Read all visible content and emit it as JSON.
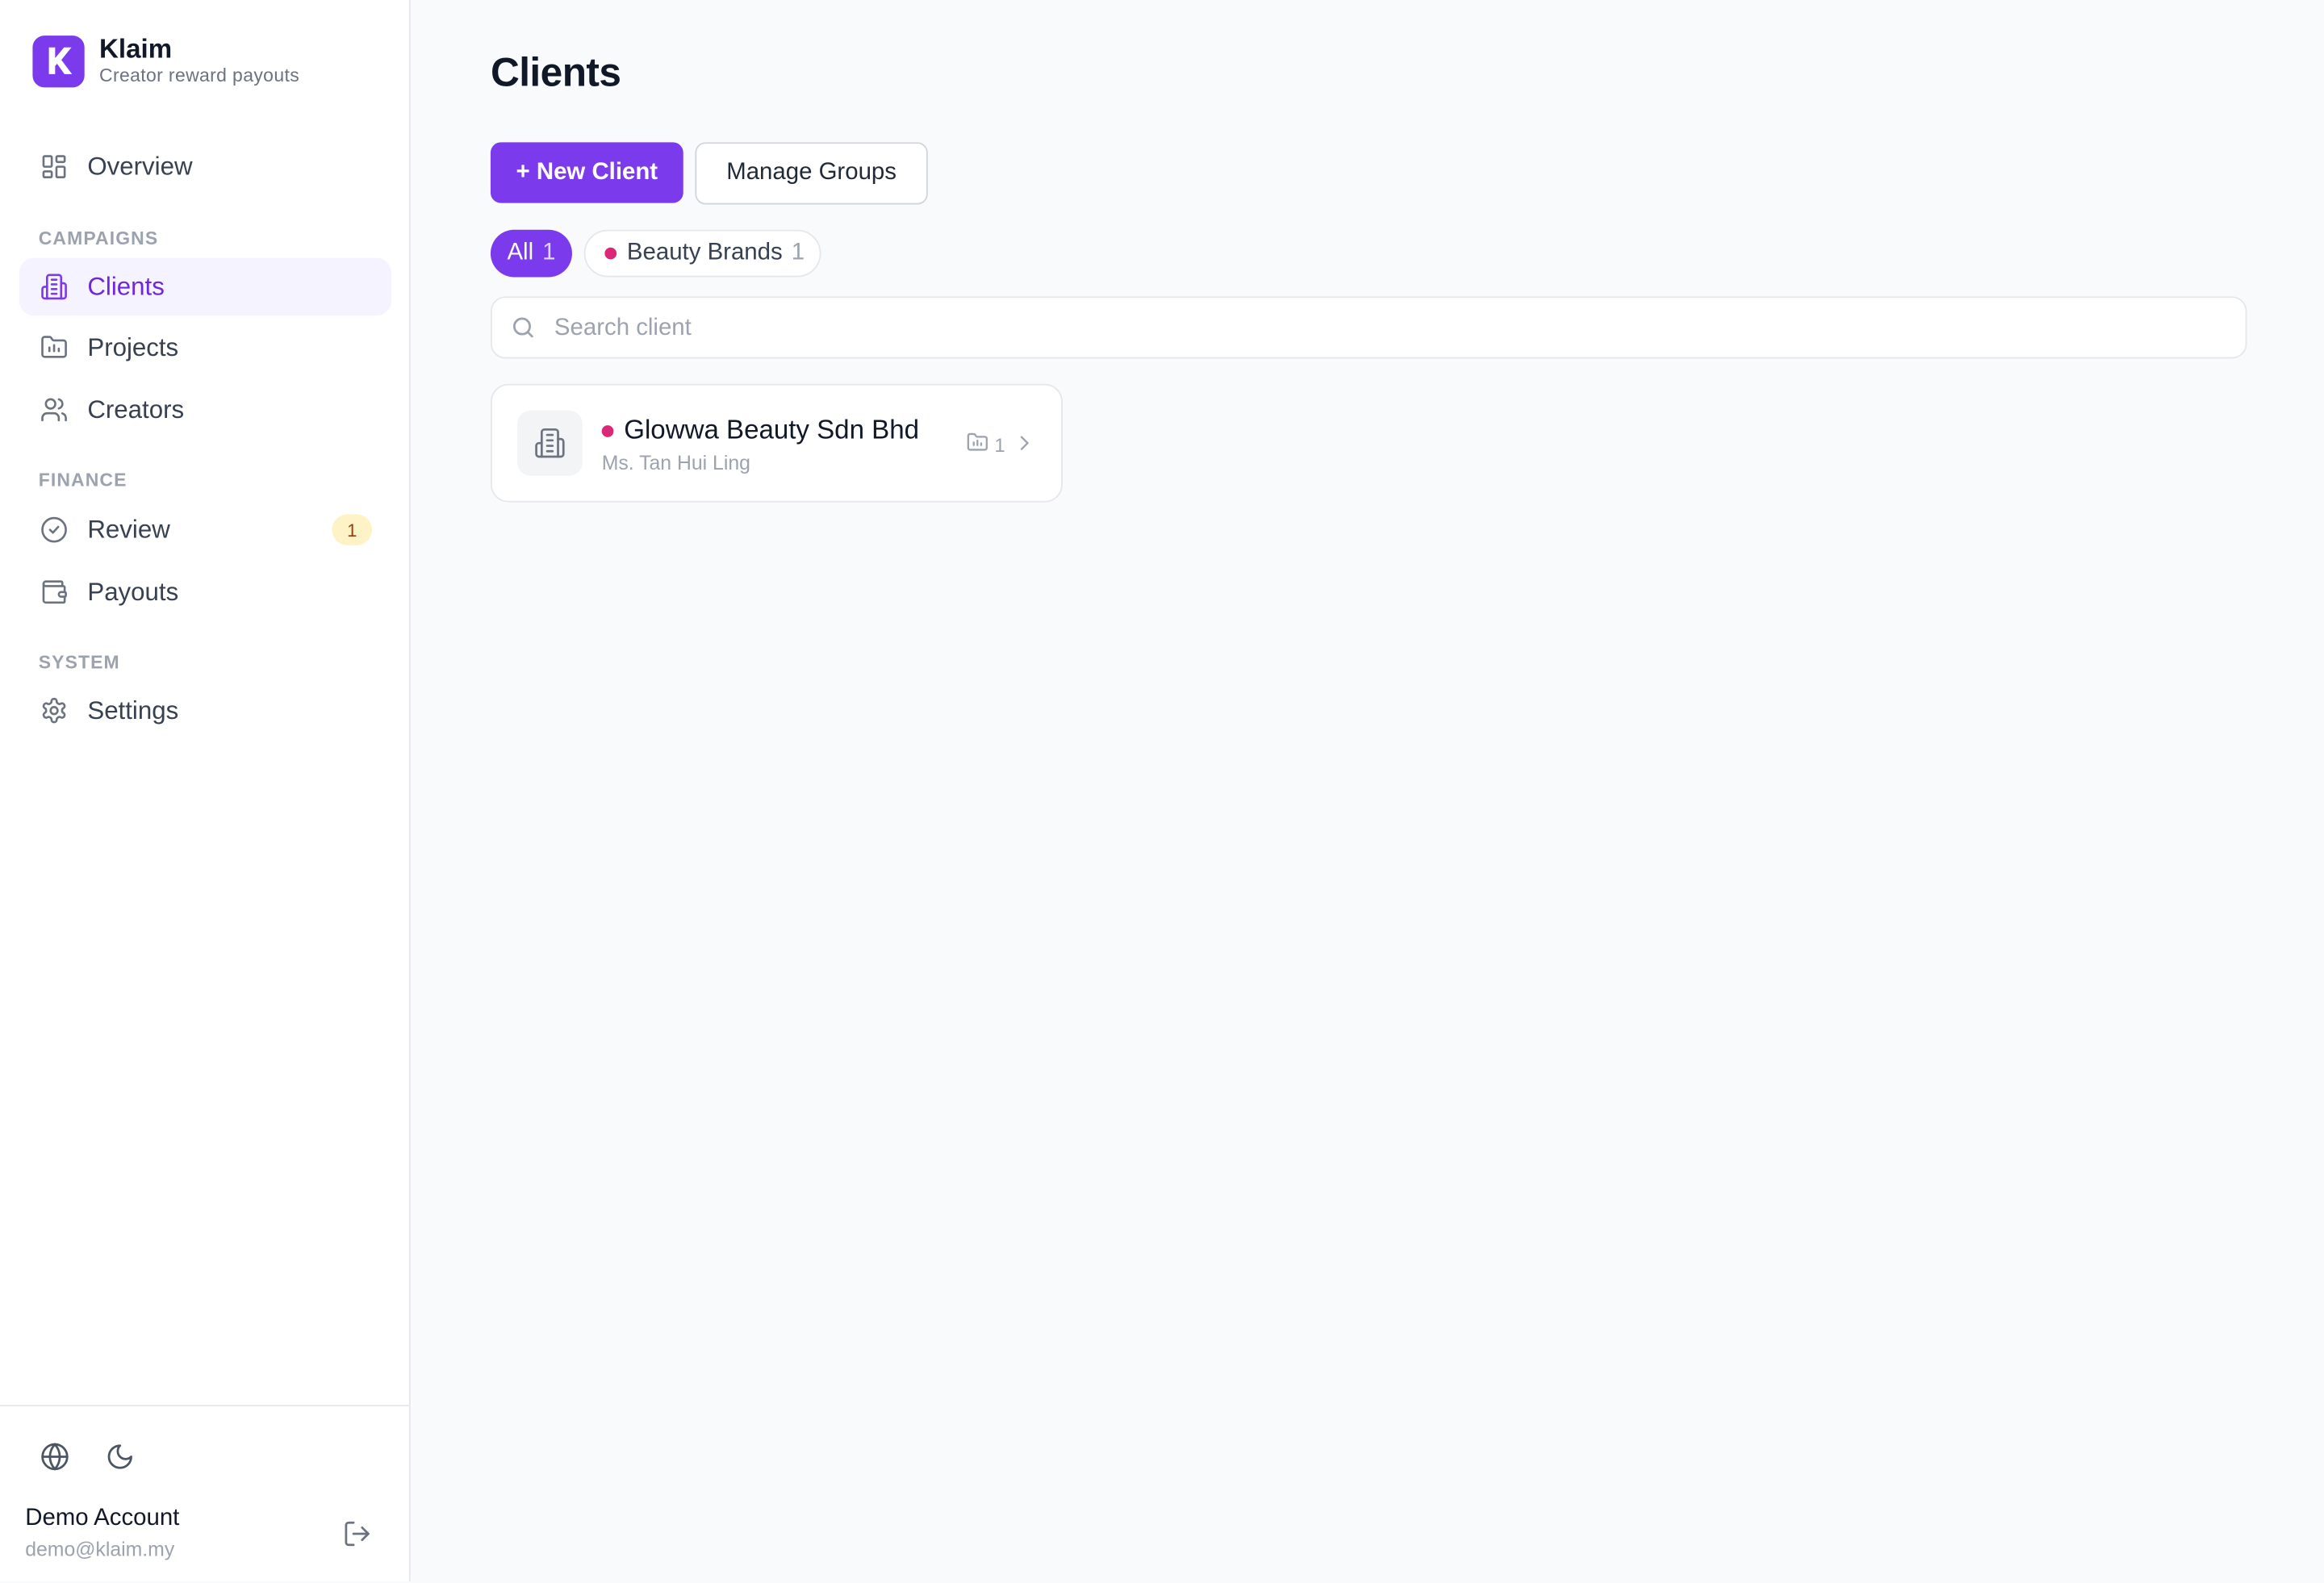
{
  "brand": {
    "name": "Klaim",
    "tagline": "Creator reward payouts",
    "logo_letter": "K",
    "accent": "#7c3aed"
  },
  "sidebar": {
    "top_items": [
      {
        "label": "Overview",
        "icon": "grid-icon"
      }
    ],
    "sections": [
      {
        "title": "CAMPAIGNS",
        "items": [
          {
            "label": "Clients",
            "icon": "building-icon",
            "active": true
          },
          {
            "label": "Projects",
            "icon": "folder-icon"
          },
          {
            "label": "Creators",
            "icon": "users-icon"
          }
        ]
      },
      {
        "title": "FINANCE",
        "items": [
          {
            "label": "Review",
            "icon": "check-circle-icon",
            "badge": "1"
          },
          {
            "label": "Payouts",
            "icon": "wallet-icon"
          }
        ]
      },
      {
        "title": "SYSTEM",
        "items": [
          {
            "label": "Settings",
            "icon": "gear-icon"
          }
        ]
      }
    ],
    "footer": {
      "user_name": "Demo Account",
      "user_email": "demo@klaim.my",
      "icons": [
        "globe-icon",
        "moon-icon",
        "logout-icon"
      ]
    }
  },
  "main": {
    "title": "Clients",
    "new_client_label": "+ New Client",
    "manage_groups_label": "Manage Groups",
    "filters": [
      {
        "label": "All",
        "count": "1",
        "active": true
      },
      {
        "label": "Beauty Brands",
        "count": "1",
        "color": "#db2777"
      }
    ],
    "search_placeholder": "Search client",
    "clients": [
      {
        "name": "Glowwa Beauty Sdn Bhd",
        "contact": "Ms. Tan Hui Ling",
        "projects": "1",
        "group_color": "#db2777"
      }
    ]
  }
}
